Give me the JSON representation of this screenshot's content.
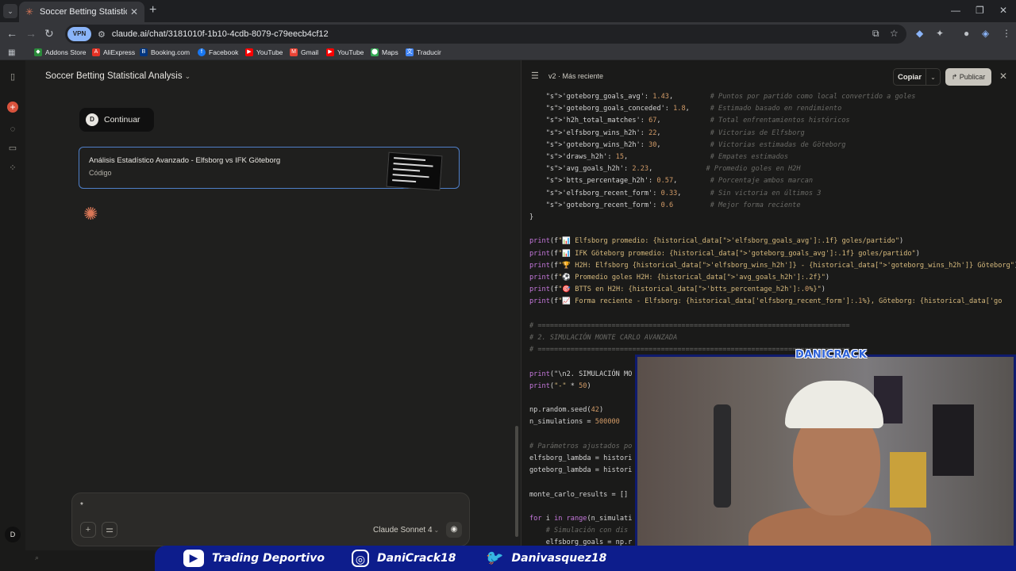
{
  "browser": {
    "tab_title": "Soccer Betting Statistical Analy...",
    "url": "claude.ai/chat/3181010f-1b10-4cdb-8079-c79eecb4cf12",
    "vpn_label": "VPN",
    "bookmarks": [
      "Addons Store",
      "AliExpress",
      "Booking.com",
      "Facebook",
      "YouTube",
      "Gmail",
      "YouTube",
      "Maps",
      "Traducir"
    ]
  },
  "rail": {
    "avatar": "D"
  },
  "chat": {
    "title": "Soccer Betting Statistical Analysis",
    "continue_label": "Continuar",
    "continue_avatar": "D",
    "artifact_title": "Análisis Estadístico Avanzado - Elfsborg vs IFK Göteborg",
    "artifact_subtitle": "Código",
    "composer_text": "*",
    "model_name": "Claude Sonnet 4"
  },
  "code_panel": {
    "version": "v2 · Más reciente",
    "copy_label": "Copiar",
    "publish_label": "Publicar",
    "lines": [
      "    'goteborg_goals_avg': 1.43,         # Puntos por partido como local convertido a goles",
      "    'goteborg_goals_conceded': 1.8,     # Estimado basado en rendimiento",
      "    'h2h_total_matches': 67,            # Total enfrentamientos históricos",
      "    'elfsborg_wins_h2h': 22,            # Victorias de Elfsborg",
      "    'goteborg_wins_h2h': 30,            # Victorias estimadas de Göteborg",
      "    'draws_h2h': 15,                    # Empates estimados",
      "    'avg_goals_h2h': 2.23,             # Promedio goles en H2H",
      "    'btts_percentage_h2h': 0.57,        # Porcentaje ambos marcan",
      "    'elfsborg_recent_form': 0.33,       # Sin victoria en últimos 3",
      "    'goteborg_recent_form': 0.6         # Mejor forma reciente",
      "}",
      "",
      "print(f\"📊 Elfsborg promedio: {historical_data['elfsborg_goals_avg']:.1f} goles/partido\")",
      "print(f\"📊 IFK Göteborg promedio: {historical_data['goteborg_goals_avg']:.1f} goles/partido\")",
      "print(f\"🏆 H2H: Elfsborg {historical_data['elfsborg_wins_h2h']} - {historical_data['goteborg_wins_h2h']} Göteborg\")",
      "print(f\"⚽ Promedio goles H2H: {historical_data['avg_goals_h2h']:.2f}\")",
      "print(f\"🎯 BTTS en H2H: {historical_data['btts_percentage_h2h']:.0%}\")",
      "print(f\"📈 Forma reciente - Elfsborg: {historical_data['elfsborg_recent_form']:.1%}, Göteborg: {historical_data['go",
      "",
      "# ============================================================================",
      "# 2. SIMULACIÓN MONTE CARLO AVANZADA",
      "# ============================================================================",
      "",
      "print(\"\\n2. SIMULACIÓN MO",
      "print(\"-\" * 50)",
      "",
      "np.random.seed(42)",
      "n_simulations = 500000",
      "",
      "# Parámetros ajustados po",
      "elfsborg_lambda = histori",
      "goteborg_lambda = histori",
      "",
      "monte_carlo_results = []",
      "",
      "for i in range(n_simulati",
      "    # Simulación con dis",
      "    elfsborg_goals = np.r"
    ]
  },
  "overlay": {
    "cam_tag": "DANICRACK",
    "socials": [
      "Trading Deportivo",
      "DaniCrack18",
      "Danivasquez18"
    ]
  }
}
